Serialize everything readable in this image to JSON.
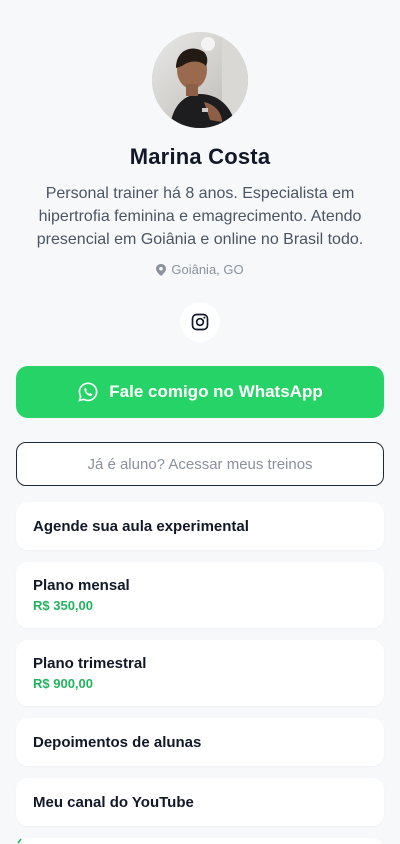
{
  "profile": {
    "name": "Marina Costa",
    "bio": "Personal trainer há 8 anos. Especialista em hipertrofia feminina e emagrecimento. Atendo presencial em Goiânia e online no Brasil todo.",
    "location": "Goiânia, GO"
  },
  "social": {
    "instagram_icon": "instagram-icon"
  },
  "cta": {
    "whatsapp_label": "Fale comigo no WhatsApp",
    "student_label": "Já é aluno? Acessar meus treinos"
  },
  "links": [
    {
      "title": "Agende sua aula experimental"
    },
    {
      "title": "Plano mensal",
      "price": "R$ 350,00"
    },
    {
      "title": "Plano trimestral",
      "price": "R$ 900,00"
    },
    {
      "title": "Depoimentos de alunas"
    },
    {
      "title": "Meu canal do YouTube"
    }
  ],
  "colors": {
    "background": "#f7f8fa",
    "whatsapp_green": "#25d366",
    "price_green": "#22b35e",
    "text_dark": "#111827",
    "text_muted": "#4b5563"
  }
}
